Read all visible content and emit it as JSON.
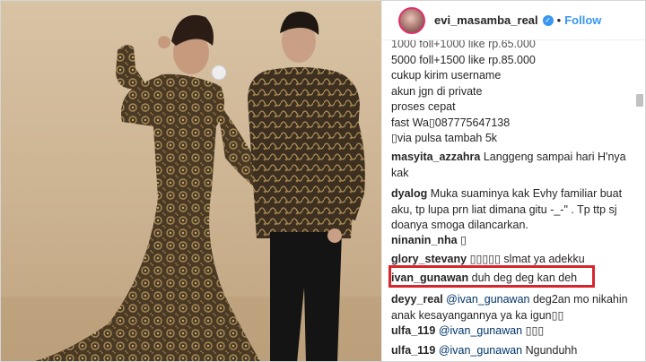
{
  "post": {
    "username": "evi_masamba_real",
    "verified_glyph": "✓",
    "separator": "•",
    "follow_label": "Follow"
  },
  "caption_lines": [
    "1000 foll+1000 like rp.65.000",
    "5000 foll+1500 like rp.85.000",
    "cukup kirim username",
    "akun jgn di private",
    "proses cepat",
    "fast Wa▯087775647138",
    "▯via pulsa tambah 5k"
  ],
  "comments": [
    {
      "user": "masyita_azzahra",
      "mention": "",
      "text": "Langgeng sampai hari H'nya kak"
    },
    {
      "user": "dyalog",
      "mention": "",
      "text": "Muka suaminya kak Evhy familiar buat aku, tp lupa prn liat dimana gitu -_-\" . Tp ttp sj doanya smoga dilancarkan."
    },
    {
      "user": "ninanin_nha",
      "mention": "",
      "text": "▯"
    },
    {
      "user": "glory_stevany",
      "mention": "",
      "text": "▯▯▯▯▯ slmat ya adekku"
    },
    {
      "user": "ivan_gunawan",
      "mention": "",
      "text": "duh deg deg kan deh"
    },
    {
      "user": "deyy_real",
      "mention": "@ivan_gunawan",
      "text": "deg2an mo nikahin anak kesayangannya ya ka igun▯▯"
    },
    {
      "user": "ulfa_119",
      "mention": "@ivan_gunawan",
      "text": "▯▯▯"
    },
    {
      "user": "ulfa_119",
      "mention": "@ivan_gunawan",
      "text": "Ngunduhh"
    }
  ],
  "colors": {
    "highlight_box": "#d7262b",
    "follow_blue": "#3897f0",
    "mention_blue": "#003569"
  },
  "icons": [
    "avatar",
    "verified-badge-icon",
    "scrollbar"
  ]
}
